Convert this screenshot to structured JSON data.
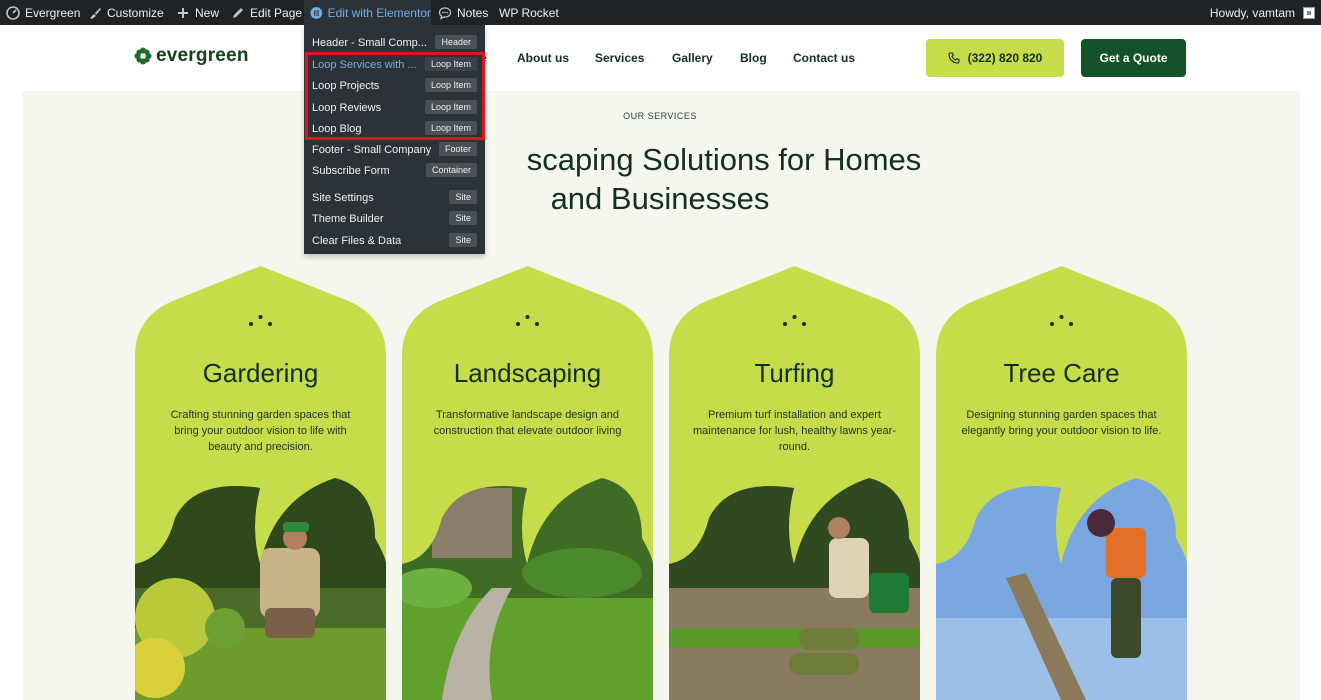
{
  "adminbar": {
    "site_name": "Evergreen",
    "customize": "Customize",
    "new": "New",
    "edit_page": "Edit Page",
    "edit_elementor": "Edit with Elementor",
    "notes": "Notes",
    "wp_rocket": "WP Rocket",
    "howdy": "Howdy, vamtam"
  },
  "elementor_menu": [
    {
      "label": "Header - Small Comp...",
      "badge": "Header",
      "highlighted": false
    },
    {
      "label": "Loop Services with ...",
      "badge": "Loop Item",
      "highlighted": true
    },
    {
      "label": "Loop Projects",
      "badge": "Loop Item",
      "highlighted": false
    },
    {
      "label": "Loop Reviews",
      "badge": "Loop Item",
      "highlighted": false
    },
    {
      "label": "Loop Blog",
      "badge": "Loop Item",
      "highlighted": false
    },
    {
      "label": "Footer - Small Company",
      "badge": "Footer",
      "highlighted": false
    },
    {
      "label": "Subscribe Form",
      "badge": "Container",
      "highlighted": false
    },
    {
      "label": "Site Settings",
      "badge": "Site",
      "highlighted": false
    },
    {
      "label": "Theme Builder",
      "badge": "Site",
      "highlighted": false
    },
    {
      "label": "Clear Files & Data",
      "badge": "Site",
      "highlighted": false
    }
  ],
  "header": {
    "logo": "evergreen",
    "nav": [
      "e",
      "About us",
      "Services",
      "Gallery",
      "Blog",
      "Contact us"
    ],
    "phone": "(322) 820 820",
    "quote": "Get a Quote"
  },
  "section": {
    "eyebrow": "OUR SERVICES",
    "heading_line1": "scaping Solutions for Homes",
    "heading_line2": "and Businesses"
  },
  "cards": [
    {
      "title": "Gardering",
      "text": "Crafting stunning garden spaces that bring your outdoor vision to life with beauty and precision."
    },
    {
      "title": "Landscaping",
      "text": "Transformative landscape design and construction that elevate outdoor living"
    },
    {
      "title": "Turfing",
      "text": "Premium turf installation and expert maintenance for lush, healthy lawns year-round."
    },
    {
      "title": "Tree Care",
      "text": "Designing stunning garden spaces that elegantly bring your outdoor vision to life."
    }
  ],
  "colors": {
    "adminbar": "#1d2327",
    "brand_green": "#14522a",
    "lime": "#c7dc4a",
    "section_bg": "#f5f6ee",
    "highlight_box": "#e3131b"
  }
}
